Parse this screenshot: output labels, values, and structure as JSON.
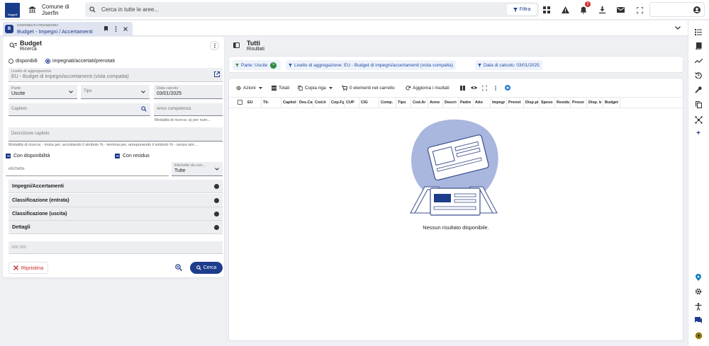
{
  "topbar": {
    "logo_text": "Maggioli",
    "entity_line1": "Comune di",
    "entity_line2": "Jserfin",
    "search_placeholder": "Cerca in tutte le aree...",
    "filter_label": "Filtra",
    "notification_count": "2"
  },
  "tab": {
    "category": "CONTABILITÀ FINANZIARIA",
    "title": "Budget - Impegni / Accertamenti"
  },
  "left": {
    "title": "Budget",
    "subtitle": "Ricerca",
    "radio_options": [
      "disponibili",
      "impegnati/accertati/prenotati"
    ],
    "selected_radio": 1,
    "livello_label": "Livello di aggregazione",
    "livello_value": "EU - Budget di impegni/accertamenti (vista compatta)",
    "parte_label": "Parte",
    "parte_value": "Uscite",
    "tipo_label": "Tipo",
    "data_calcolo_label": "Data calcolo",
    "data_calcolo_value": "03/01/2025",
    "capitolo_label": "Capitolo",
    "anno_label": "Anno competenza",
    "anno_hint": "Modalità di ricerca: a) per num...",
    "descrizione_label": "Descrizione capitolo",
    "descrizione_hint": "Modalità di ricerca: - inizia per, accodando il simbolo % - termina per, anteponendo il simbolo % - senza sim...",
    "check_disponibilita": "Con disponibilità",
    "check_residuo": "Con residuo",
    "etichette_label": "etichette",
    "etichette_con_label": "Etichette da con...",
    "etichette_con_value": "Tutte",
    "accordions": [
      "Impegni/Accertamenti",
      "Classificazione (entrata)",
      "Classificazione (uscita)",
      "Dettagli"
    ],
    "altri_filtri": "Altri filtri",
    "reset_label": "Ripristina",
    "search_label": "Cerca"
  },
  "right": {
    "title": "Tutti",
    "subtitle": "Risultati",
    "chips": [
      "Parte: Uscite",
      "Livello di aggregazione: EU - Budget di impegni/accertamenti (vista compatta)",
      "Data di calcolo: 03/01/2025"
    ],
    "toolbar": {
      "azioni": "Azioni",
      "totali": "Totali",
      "copia_riga": "Copia riga",
      "carrello": "0 elementi nel carrello",
      "aggiorna": "Aggiorna i risultati"
    },
    "columns": [
      "EU",
      "Tit.",
      "Capitol",
      "Des.Ca",
      "Cod.Ir",
      "Cop.Fg",
      "CUP",
      "CIG",
      "Comp.",
      "Tipo",
      "Cod.Ar",
      "Anno",
      "Descri",
      "Padre",
      "Atto",
      "Impegr",
      "Prenot",
      "Disp.pi",
      "Speso",
      "Residu",
      "Prossi",
      "Disp. b",
      "Budget"
    ],
    "empty_text": "Nessun risultato disponibile."
  },
  "colors": {
    "primary": "#1e3c8c",
    "chip_text": "#1f4ea3",
    "danger": "#c62828",
    "notification": "#d32f2f"
  }
}
